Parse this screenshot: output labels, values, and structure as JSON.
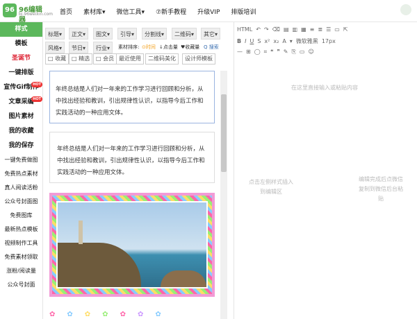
{
  "logo": {
    "badge": "96",
    "name": "96编辑器",
    "url": "bj.96weixin.com"
  },
  "nav": [
    "首页",
    "素材库▾",
    "微信工具▾",
    "⑦新手教程",
    "升级VIP",
    "排版培训"
  ],
  "left_items": [
    {
      "label": "样式"
    },
    {
      "label": "模板"
    },
    {
      "label": "圣诞节"
    },
    {
      "label": "一键排版"
    },
    {
      "label": "宣传Gif制作"
    },
    {
      "label": "文章采编"
    },
    {
      "label": "图片素材"
    },
    {
      "label": "我的收藏"
    },
    {
      "label": "我的保存"
    },
    {
      "label": "一键免费做图"
    },
    {
      "label": "免费热点素材"
    },
    {
      "label": "真人阅读活粉"
    },
    {
      "label": "公众号封面图"
    },
    {
      "label": "免费图库"
    },
    {
      "label": "最新热点模板"
    },
    {
      "label": "视频制作工具"
    },
    {
      "label": "免费素材领取"
    },
    {
      "label": "涨粉/阅读量"
    },
    {
      "label": "公众号封面"
    }
  ],
  "cats_row1": [
    "标题▾",
    "正文▾",
    "图文▾",
    "引导▾",
    "分割线▾",
    "二维码▾",
    "其它▾"
  ],
  "cats_row2": [
    "风格▾",
    "节日▾",
    "行业▾",
    "素材排序:",
    "⊙时间",
    "↓点击量",
    "♥收藏量",
    "Q 搜索"
  ],
  "row3": [
    "□ 收藏",
    "□ 精选",
    "□ 会员",
    "最近使用",
    "二维码美化",
    "设计师模板"
  ],
  "card_text": "年终总结是人们对一年来的工作学习进行回顾和分析，从中找出经验和教训，引出规律性认识，以指导今后工作和实践活动的一种应用文体。",
  "editor": {
    "font": "微软雅黑",
    "size": "17px",
    "placeholder": "在这里直接输入或粘贴内容",
    "left_hint": "点击左侧样式插入到编辑区",
    "right_hint": "编辑完成后点微信复制到微信后台粘贴"
  },
  "hot_label": "HOT"
}
